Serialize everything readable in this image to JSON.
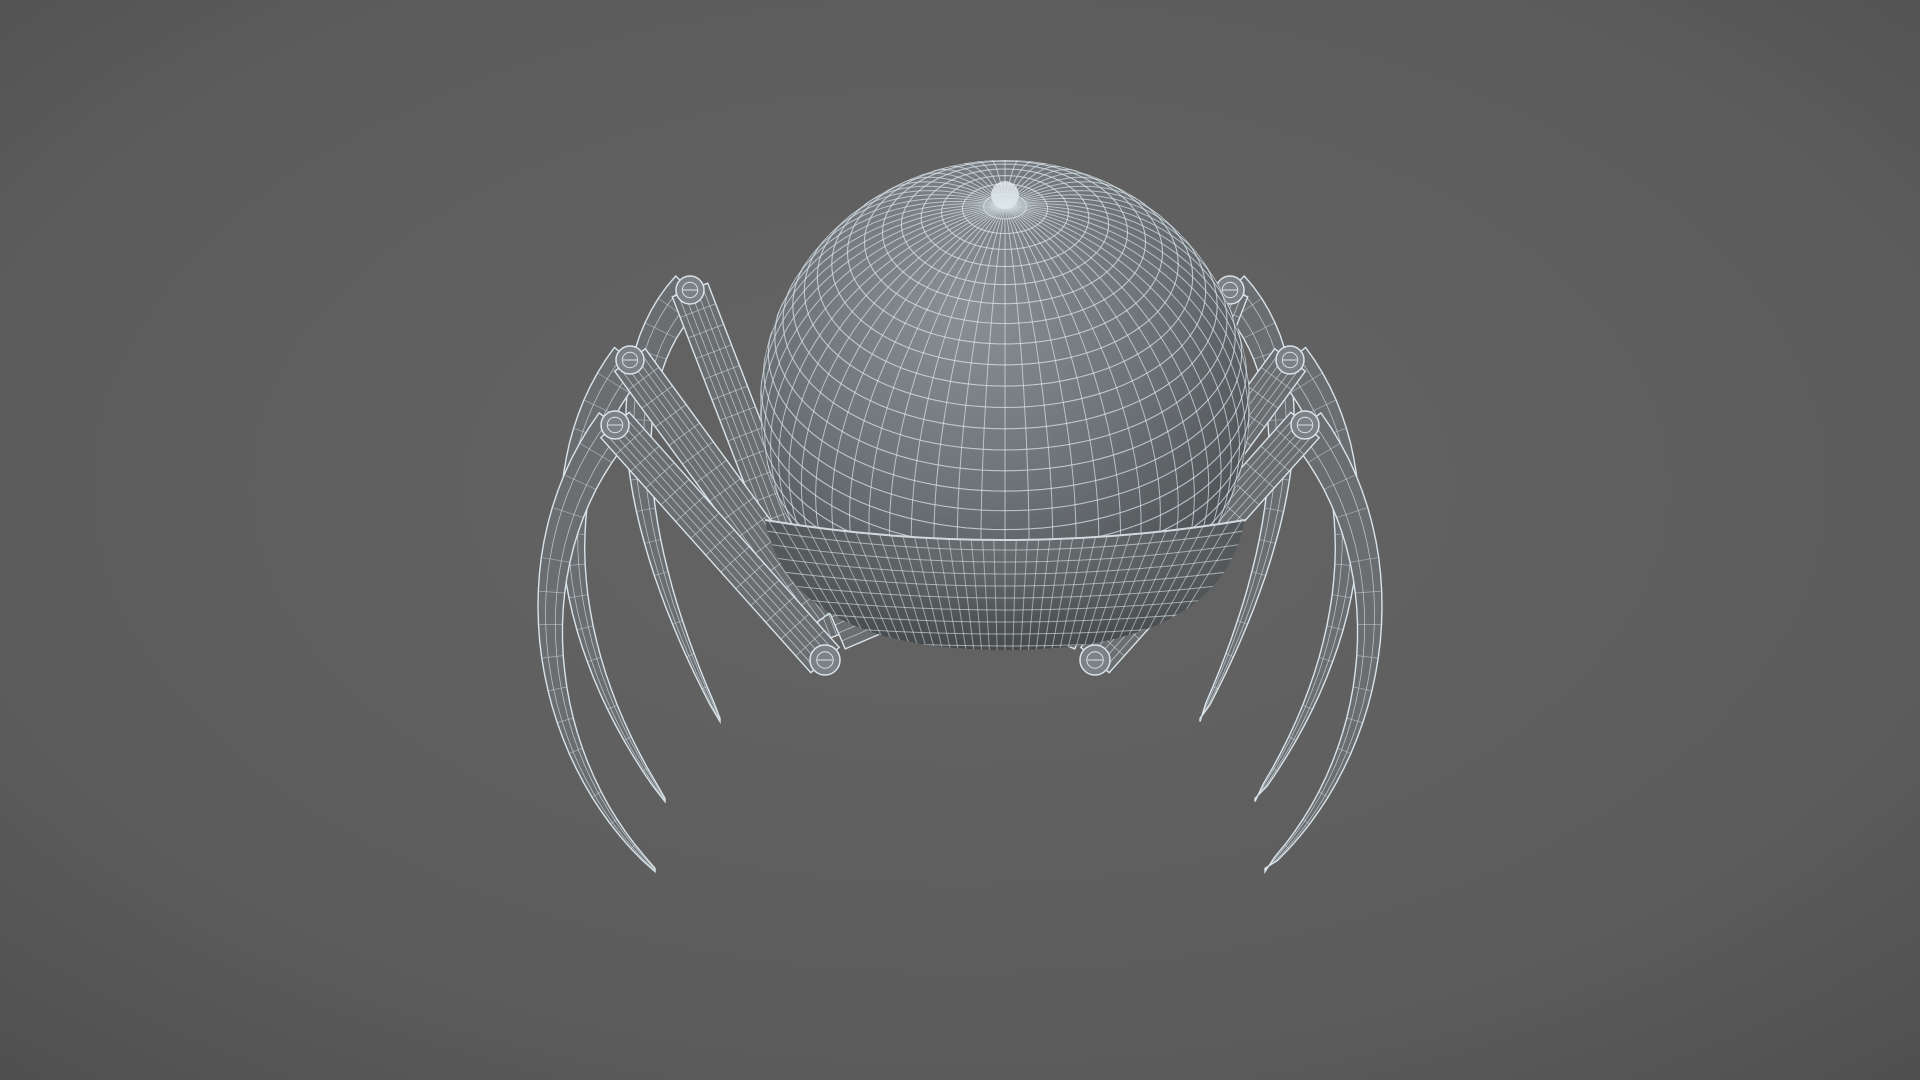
{
  "render": {
    "subject": "spider-robot-model",
    "view_mode": "wireframe-shaded",
    "background_color": "#5f5f5f",
    "vignette_color": "#4e4e4e",
    "mesh_fill_color": "#6a6e70",
    "mesh_line_color": "#d9e4ea",
    "leg_count": 6
  }
}
